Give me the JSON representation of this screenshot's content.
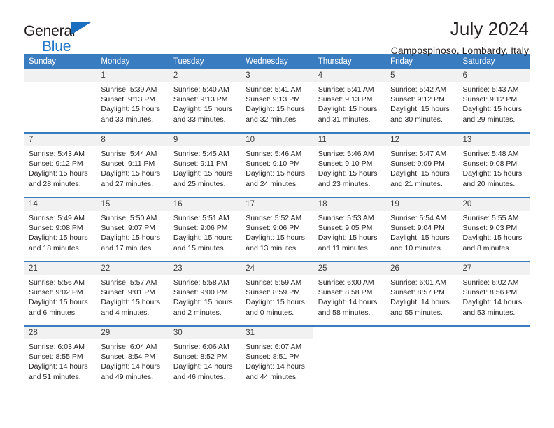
{
  "brand": {
    "name_part1": "General",
    "name_part2": "Blue"
  },
  "header": {
    "title": "July 2024",
    "subtitle": "Campospinoso, Lombardy, Italy"
  },
  "colors": {
    "header_blue": "#3a7cc0",
    "brand_blue": "#2277c8",
    "daynum_band": "#f1f1f1"
  },
  "weekday_headers": [
    "Sunday",
    "Monday",
    "Tuesday",
    "Wednesday",
    "Thursday",
    "Friday",
    "Saturday"
  ],
  "labels": {
    "sunrise_prefix": "Sunrise:",
    "sunset_prefix": "Sunset:",
    "daylight_prefix": "Daylight:"
  },
  "weeks": [
    [
      {
        "day": "",
        "sunrise": "",
        "sunset": "",
        "daylight_line1": "",
        "daylight_line2": ""
      },
      {
        "day": "1",
        "sunrise": "Sunrise: 5:39 AM",
        "sunset": "Sunset: 9:13 PM",
        "daylight_line1": "Daylight: 15 hours",
        "daylight_line2": "and 33 minutes."
      },
      {
        "day": "2",
        "sunrise": "Sunrise: 5:40 AM",
        "sunset": "Sunset: 9:13 PM",
        "daylight_line1": "Daylight: 15 hours",
        "daylight_line2": "and 33 minutes."
      },
      {
        "day": "3",
        "sunrise": "Sunrise: 5:41 AM",
        "sunset": "Sunset: 9:13 PM",
        "daylight_line1": "Daylight: 15 hours",
        "daylight_line2": "and 32 minutes."
      },
      {
        "day": "4",
        "sunrise": "Sunrise: 5:41 AM",
        "sunset": "Sunset: 9:13 PM",
        "daylight_line1": "Daylight: 15 hours",
        "daylight_line2": "and 31 minutes."
      },
      {
        "day": "5",
        "sunrise": "Sunrise: 5:42 AM",
        "sunset": "Sunset: 9:12 PM",
        "daylight_line1": "Daylight: 15 hours",
        "daylight_line2": "and 30 minutes."
      },
      {
        "day": "6",
        "sunrise": "Sunrise: 5:43 AM",
        "sunset": "Sunset: 9:12 PM",
        "daylight_line1": "Daylight: 15 hours",
        "daylight_line2": "and 29 minutes."
      }
    ],
    [
      {
        "day": "7",
        "sunrise": "Sunrise: 5:43 AM",
        "sunset": "Sunset: 9:12 PM",
        "daylight_line1": "Daylight: 15 hours",
        "daylight_line2": "and 28 minutes."
      },
      {
        "day": "8",
        "sunrise": "Sunrise: 5:44 AM",
        "sunset": "Sunset: 9:11 PM",
        "daylight_line1": "Daylight: 15 hours",
        "daylight_line2": "and 27 minutes."
      },
      {
        "day": "9",
        "sunrise": "Sunrise: 5:45 AM",
        "sunset": "Sunset: 9:11 PM",
        "daylight_line1": "Daylight: 15 hours",
        "daylight_line2": "and 25 minutes."
      },
      {
        "day": "10",
        "sunrise": "Sunrise: 5:46 AM",
        "sunset": "Sunset: 9:10 PM",
        "daylight_line1": "Daylight: 15 hours",
        "daylight_line2": "and 24 minutes."
      },
      {
        "day": "11",
        "sunrise": "Sunrise: 5:46 AM",
        "sunset": "Sunset: 9:10 PM",
        "daylight_line1": "Daylight: 15 hours",
        "daylight_line2": "and 23 minutes."
      },
      {
        "day": "12",
        "sunrise": "Sunrise: 5:47 AM",
        "sunset": "Sunset: 9:09 PM",
        "daylight_line1": "Daylight: 15 hours",
        "daylight_line2": "and 21 minutes."
      },
      {
        "day": "13",
        "sunrise": "Sunrise: 5:48 AM",
        "sunset": "Sunset: 9:08 PM",
        "daylight_line1": "Daylight: 15 hours",
        "daylight_line2": "and 20 minutes."
      }
    ],
    [
      {
        "day": "14",
        "sunrise": "Sunrise: 5:49 AM",
        "sunset": "Sunset: 9:08 PM",
        "daylight_line1": "Daylight: 15 hours",
        "daylight_line2": "and 18 minutes."
      },
      {
        "day": "15",
        "sunrise": "Sunrise: 5:50 AM",
        "sunset": "Sunset: 9:07 PM",
        "daylight_line1": "Daylight: 15 hours",
        "daylight_line2": "and 17 minutes."
      },
      {
        "day": "16",
        "sunrise": "Sunrise: 5:51 AM",
        "sunset": "Sunset: 9:06 PM",
        "daylight_line1": "Daylight: 15 hours",
        "daylight_line2": "and 15 minutes."
      },
      {
        "day": "17",
        "sunrise": "Sunrise: 5:52 AM",
        "sunset": "Sunset: 9:06 PM",
        "daylight_line1": "Daylight: 15 hours",
        "daylight_line2": "and 13 minutes."
      },
      {
        "day": "18",
        "sunrise": "Sunrise: 5:53 AM",
        "sunset": "Sunset: 9:05 PM",
        "daylight_line1": "Daylight: 15 hours",
        "daylight_line2": "and 11 minutes."
      },
      {
        "day": "19",
        "sunrise": "Sunrise: 5:54 AM",
        "sunset": "Sunset: 9:04 PM",
        "daylight_line1": "Daylight: 15 hours",
        "daylight_line2": "and 10 minutes."
      },
      {
        "day": "20",
        "sunrise": "Sunrise: 5:55 AM",
        "sunset": "Sunset: 9:03 PM",
        "daylight_line1": "Daylight: 15 hours",
        "daylight_line2": "and 8 minutes."
      }
    ],
    [
      {
        "day": "21",
        "sunrise": "Sunrise: 5:56 AM",
        "sunset": "Sunset: 9:02 PM",
        "daylight_line1": "Daylight: 15 hours",
        "daylight_line2": "and 6 minutes."
      },
      {
        "day": "22",
        "sunrise": "Sunrise: 5:57 AM",
        "sunset": "Sunset: 9:01 PM",
        "daylight_line1": "Daylight: 15 hours",
        "daylight_line2": "and 4 minutes."
      },
      {
        "day": "23",
        "sunrise": "Sunrise: 5:58 AM",
        "sunset": "Sunset: 9:00 PM",
        "daylight_line1": "Daylight: 15 hours",
        "daylight_line2": "and 2 minutes."
      },
      {
        "day": "24",
        "sunrise": "Sunrise: 5:59 AM",
        "sunset": "Sunset: 8:59 PM",
        "daylight_line1": "Daylight: 15 hours",
        "daylight_line2": "and 0 minutes."
      },
      {
        "day": "25",
        "sunrise": "Sunrise: 6:00 AM",
        "sunset": "Sunset: 8:58 PM",
        "daylight_line1": "Daylight: 14 hours",
        "daylight_line2": "and 58 minutes."
      },
      {
        "day": "26",
        "sunrise": "Sunrise: 6:01 AM",
        "sunset": "Sunset: 8:57 PM",
        "daylight_line1": "Daylight: 14 hours",
        "daylight_line2": "and 55 minutes."
      },
      {
        "day": "27",
        "sunrise": "Sunrise: 6:02 AM",
        "sunset": "Sunset: 8:56 PM",
        "daylight_line1": "Daylight: 14 hours",
        "daylight_line2": "and 53 minutes."
      }
    ],
    [
      {
        "day": "28",
        "sunrise": "Sunrise: 6:03 AM",
        "sunset": "Sunset: 8:55 PM",
        "daylight_line1": "Daylight: 14 hours",
        "daylight_line2": "and 51 minutes."
      },
      {
        "day": "29",
        "sunrise": "Sunrise: 6:04 AM",
        "sunset": "Sunset: 8:54 PM",
        "daylight_line1": "Daylight: 14 hours",
        "daylight_line2": "and 49 minutes."
      },
      {
        "day": "30",
        "sunrise": "Sunrise: 6:06 AM",
        "sunset": "Sunset: 8:52 PM",
        "daylight_line1": "Daylight: 14 hours",
        "daylight_line2": "and 46 minutes."
      },
      {
        "day": "31",
        "sunrise": "Sunrise: 6:07 AM",
        "sunset": "Sunset: 8:51 PM",
        "daylight_line1": "Daylight: 14 hours",
        "daylight_line2": "and 44 minutes."
      },
      {
        "day": "",
        "sunrise": "",
        "sunset": "",
        "daylight_line1": "",
        "daylight_line2": ""
      },
      {
        "day": "",
        "sunrise": "",
        "sunset": "",
        "daylight_line1": "",
        "daylight_line2": ""
      },
      {
        "day": "",
        "sunrise": "",
        "sunset": "",
        "daylight_line1": "",
        "daylight_line2": ""
      }
    ]
  ]
}
